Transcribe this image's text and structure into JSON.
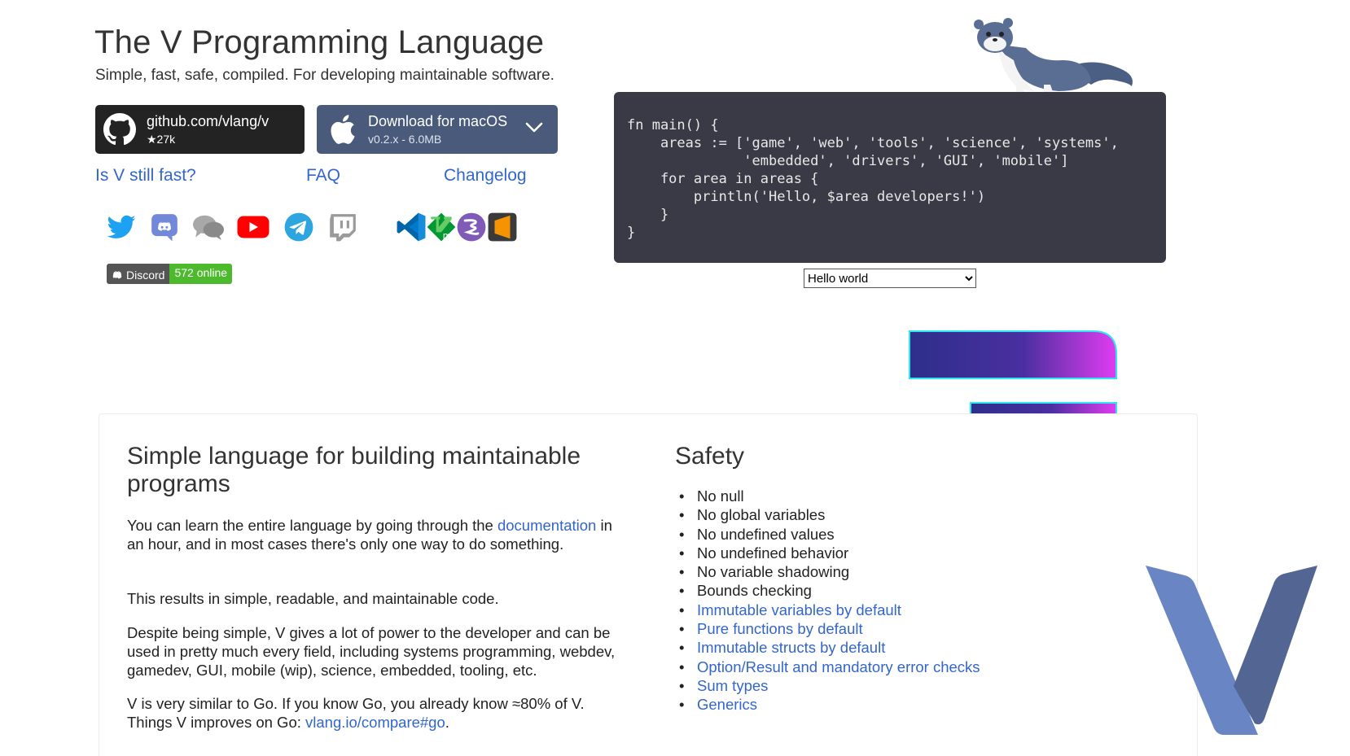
{
  "header": {
    "title": "The V Programming Language",
    "subtitle": "Simple, fast, safe, compiled. For developing maintainable software."
  },
  "buttons": {
    "github": {
      "label": "github.com/vlang/v",
      "stars": "★27k"
    },
    "download": {
      "label": "Download for macOS",
      "version": "v0.2.x - 6.0MB"
    }
  },
  "nav": {
    "fast": "Is V still fast?",
    "faq": "FAQ",
    "changelog": "Changelog"
  },
  "social_icons": [
    "twitter-icon",
    "discord-icon",
    "chat-icon",
    "youtube-icon",
    "telegram-icon",
    "twitch-icon"
  ],
  "editor_icons": [
    "vscode-icon",
    "vim-icon",
    "emacs-icon",
    "sublime-icon"
  ],
  "badge": {
    "left": "Discord",
    "right": "572 online"
  },
  "code": {
    "lines": [
      "fn main() {",
      "    areas := ['game', 'web', 'tools', 'science', 'systems',",
      "              'embedded', 'drivers', 'GUI', 'mobile']",
      "    for area in areas {",
      "        println('Hello, $area developers!')",
      "    }",
      "}"
    ],
    "example_selected": "Hello world"
  },
  "section_simple": {
    "title": "Simple language for building maintainable programs",
    "p1_before": "You can learn the entire language by going through the ",
    "p1_link": "documentation",
    "p1_after": " in an hour, and in most cases there's only one way to do something.",
    "p2": "This results in simple, readable, and maintainable code.",
    "p3": "Despite being simple, V gives a lot of power to the developer and can be used in pretty much every field, including systems programming, webdev, gamedev, GUI, mobile (wip), science, embedded, tooling, etc.",
    "p4_before": "V is very similar to Go. If you know Go, you already know ≈80% of V. Things V improves on Go: ",
    "p4_link": "vlang.io/compare#go",
    "p4_after": "."
  },
  "section_safety": {
    "title": "Safety",
    "items": [
      "No null",
      "No global variables",
      "No undefined values",
      "No undefined behavior",
      "No variable shadowing",
      "Bounds checking",
      "Immutable variables by default",
      "Pure functions by default",
      "Immutable structs by default",
      "Option/Result and mandatory error checks",
      "Sum types",
      "Generics"
    ]
  },
  "colors": {
    "link": "#3366cc",
    "code_bg": "#393a45",
    "github_btn": "#232323",
    "download_btn": "#4a5a7b",
    "badge_green": "#4cba2c"
  }
}
